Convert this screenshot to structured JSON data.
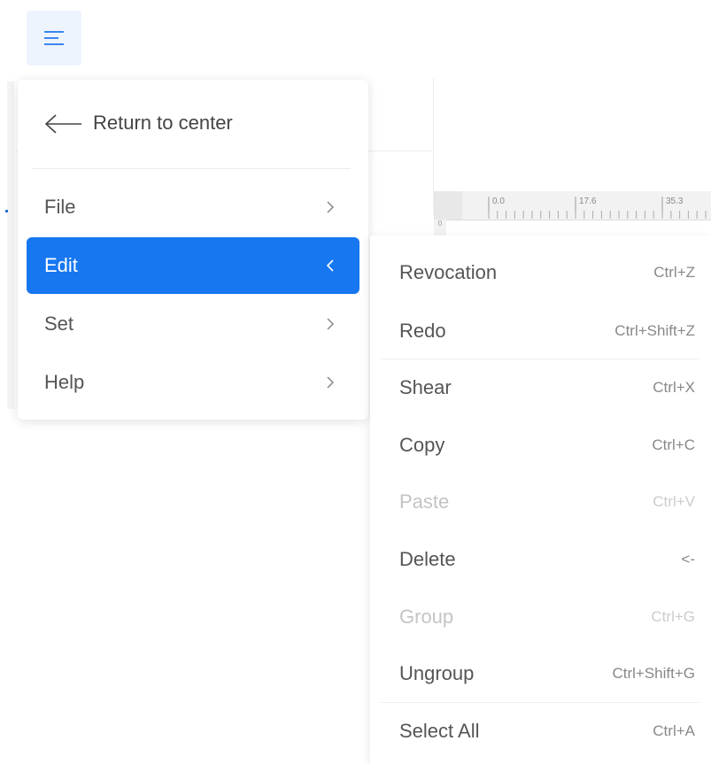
{
  "toolbar": {
    "menu_icon": "hamburger-menu-icon",
    "accent": "#1677f0"
  },
  "ruler": {
    "labels": [
      "0.0",
      "17.6",
      "35.3"
    ],
    "vertical_label": "0"
  },
  "main_menu": {
    "return_label": "Return to center",
    "items": [
      {
        "label": "File",
        "active": false
      },
      {
        "label": "Edit",
        "active": true
      },
      {
        "label": "Set",
        "active": false
      },
      {
        "label": "Help",
        "active": false
      }
    ]
  },
  "edit_submenu": {
    "items": [
      {
        "label": "Revocation",
        "shortcut": "Ctrl+Z",
        "disabled": false
      },
      {
        "label": "Redo",
        "shortcut": "Ctrl+Shift+Z",
        "disabled": false
      },
      {
        "label": "Shear",
        "shortcut": "Ctrl+X",
        "disabled": false
      },
      {
        "label": "Copy",
        "shortcut": "Ctrl+C",
        "disabled": false
      },
      {
        "label": "Paste",
        "shortcut": "Ctrl+V",
        "disabled": true
      },
      {
        "label": "Delete",
        "shortcut": "<-",
        "disabled": false
      },
      {
        "label": "Group",
        "shortcut": "Ctrl+G",
        "disabled": true
      },
      {
        "label": "Ungroup",
        "shortcut": "Ctrl+Shift+G",
        "disabled": false
      },
      {
        "label": "Select All",
        "shortcut": "Ctrl+A",
        "disabled": false
      }
    ]
  }
}
